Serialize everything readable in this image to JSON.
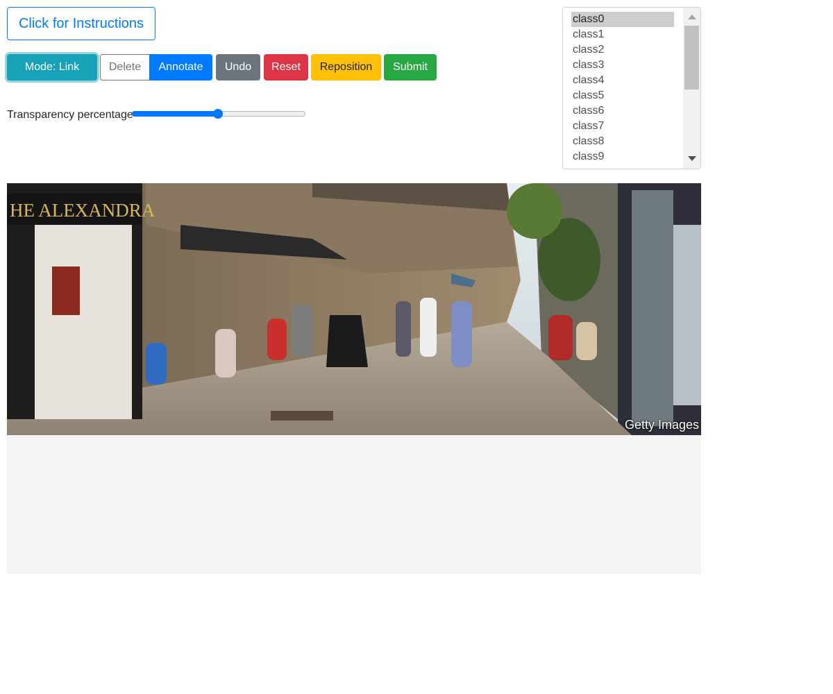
{
  "toolbar": {
    "instructions_label": "Click for Instructions",
    "mode_label": "Mode: Link",
    "delete_label": "Delete",
    "annotate_label": "Annotate",
    "undo_label": "Undo",
    "reset_label": "Reset",
    "reposition_label": "Reposition",
    "submit_label": "Submit"
  },
  "transparency": {
    "label": "Transparency percentage",
    "value_percent": 50
  },
  "class_list": {
    "selected": "class0",
    "items": [
      "class0",
      "class1",
      "class2",
      "class3",
      "class4",
      "class5",
      "class6",
      "class7",
      "class8",
      "class9"
    ]
  },
  "image": {
    "watermark": "Getty Images",
    "sign_text": "HE ALEXANDRA"
  },
  "colors": {
    "mode": "#17a2b8",
    "annotate": "#007bff",
    "undo": "#6c757d",
    "reset": "#dc3545",
    "reposition": "#ffc107",
    "submit": "#28a745"
  }
}
